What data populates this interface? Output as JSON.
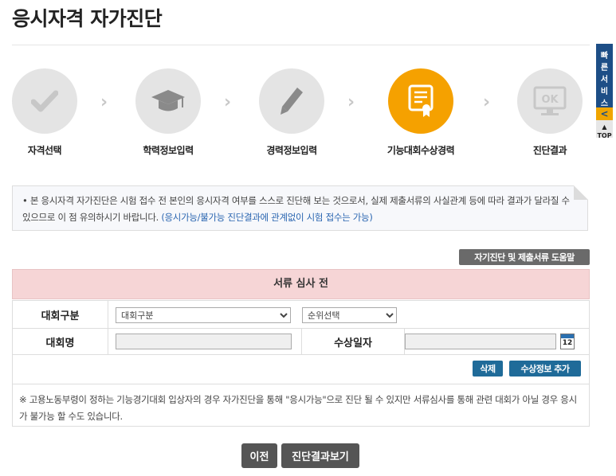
{
  "page": {
    "title": "응시자격 자가진단"
  },
  "steps": [
    {
      "label": "자격선택",
      "icon": "check-icon",
      "state": "done"
    },
    {
      "label": "학력정보입력",
      "icon": "graduation-cap-icon",
      "state": "done"
    },
    {
      "label": "경력정보입력",
      "icon": "pencil-icon",
      "state": "done"
    },
    {
      "label": "기능대회수상경력",
      "icon": "certificate-icon",
      "state": "active"
    },
    {
      "label": "진단결과",
      "icon": "ok-monitor-icon",
      "state": "pending",
      "icon_text": "OK"
    }
  ],
  "quickbar": {
    "label": "빠른서비스",
    "toggle": "<",
    "top": "TOP"
  },
  "notice": {
    "bullet": "•",
    "text": "본 응시자격 자가진단은 시험 접수 전 본인의 응시자격 여부를 스스로 진단해 보는 것으로서, 실제 제출서류의 사실관계 등에 따라 결과가 달라질 수 있으므로 이 점 유의하시기 바랍니다.",
    "highlight": "(응시가능/불가능 진단결과에 관계없이 시험 접수는 가능)"
  },
  "help_button": "자기진단 및 제출서류 도움말",
  "review_status": "서류 심사 전",
  "form": {
    "competition_type": {
      "label": "대회구분",
      "selected": "대회구분"
    },
    "rank": {
      "selected": "순위선택"
    },
    "competition_name": {
      "label": "대회명",
      "value": ""
    },
    "award_date": {
      "label": "수상일자",
      "value": "",
      "calendar_text": "12"
    },
    "delete_button": "삭제",
    "add_button": "수상정보 추가",
    "note": "※ 고용노동부령이 정하는 기능경기대회 입상자의 경우 자가진단을 통해 \"응시가능\"으로 진단 될 수 있지만 서류심사를 통해 관련 대회가 아닐 경우 응시가 불가능 할 수도 있습니다."
  },
  "buttons": {
    "prev": "이전",
    "result": "진단결과보기"
  },
  "colors": {
    "active_step": "#f5a100",
    "inactive_step": "#e4e4e4",
    "review_bar": "#f6d5d6",
    "action_blue": "#1f6b99",
    "quickbar": "#1d4e86"
  }
}
